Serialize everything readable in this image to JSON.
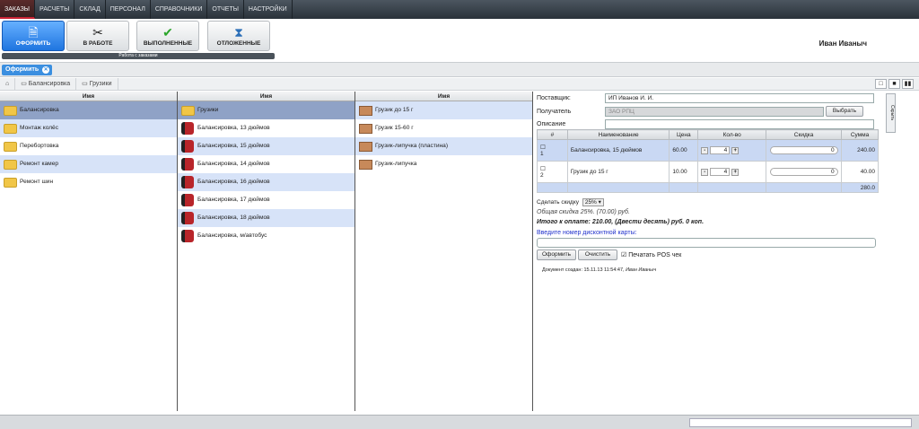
{
  "topnav": [
    "ЗАКАЗЫ",
    "РАСЧЕТЫ",
    "СКЛАД",
    "ПЕРСОНАЛ",
    "СПРАВОЧНИКИ",
    "ОТЧЕТЫ",
    "НАСТРОЙКИ"
  ],
  "toolbar": {
    "buttons": [
      {
        "label": "ОФОРМИТЬ",
        "icon": "document-icon"
      },
      {
        "label": "В РАБОТЕ",
        "icon": "tools-icon"
      },
      {
        "label": "ВЫПОЛНЕННЫЕ",
        "icon": "checkmark-icon"
      },
      {
        "label": "ОТЛОЖЕННЫЕ",
        "icon": "hourglass-icon"
      }
    ],
    "caption": "Работа с заказами"
  },
  "user": "Иван Иваныч",
  "tab_chip": "Оформить",
  "crumbs": [
    "Балансировка",
    "Грузики"
  ],
  "columns": {
    "header": "Имя",
    "c1": [
      "Балансировка",
      "Монтаж колёс",
      "Перебортовка",
      "Ремонт камер",
      "Ремонт шин"
    ],
    "c2": [
      "Грузики",
      "Балансировка, 13 дюймов",
      "Балансировка, 15 дюймов",
      "Балансировка, 14 дюймов",
      "Балансировка, 16 дюймов",
      "Балансировка, 17 дюймов",
      "Балансировка, 18 дюймов",
      "Балансировка, м/автобус"
    ],
    "c3": [
      "Грузик до 15 г",
      "Грузик 15-60 г",
      "Грузик-липучка (пластина)",
      "Грузик-липучка"
    ]
  },
  "form": {
    "supplier_label": "Поставщик:",
    "supplier_value": "ИП Иванов И. И.",
    "recipient_label": "Получатель",
    "recipient_value": "ЗАО РПЦ",
    "choose": "Выбрать",
    "description_label": "Описание"
  },
  "grid": {
    "headers": [
      "#",
      "Наименование",
      "Цена",
      "Кол-во",
      "Скидка",
      "Сумма"
    ],
    "rows": [
      {
        "n": "1",
        "name": "Балансировка, 15 дюймов",
        "price": "60.00",
        "qty": "4",
        "disc": "0",
        "sum": "240.00"
      },
      {
        "n": "2",
        "name": "Грузик до 15 г",
        "price": "10.00",
        "qty": "4",
        "disc": "0",
        "sum": "40.00"
      }
    ],
    "total": "280.0"
  },
  "summary": {
    "discount_label": "Сделать скидку",
    "discount_value": "25%",
    "total_discount": "Общая скидка 25%. (70.00) руб.",
    "to_pay": "Итого к оплате: 210.00, (Двести десять) руб. 0 коп.",
    "card_link": "Введите номер дисконтной карты:",
    "btn_checkout": "Оформить",
    "btn_clear": "Очистить",
    "pos_label": "Печатать POS чек",
    "created": "Документ создан: 15.11.13 11:54:47,",
    "created_by": "Иван Иваныч"
  },
  "hide": "Скрыть"
}
